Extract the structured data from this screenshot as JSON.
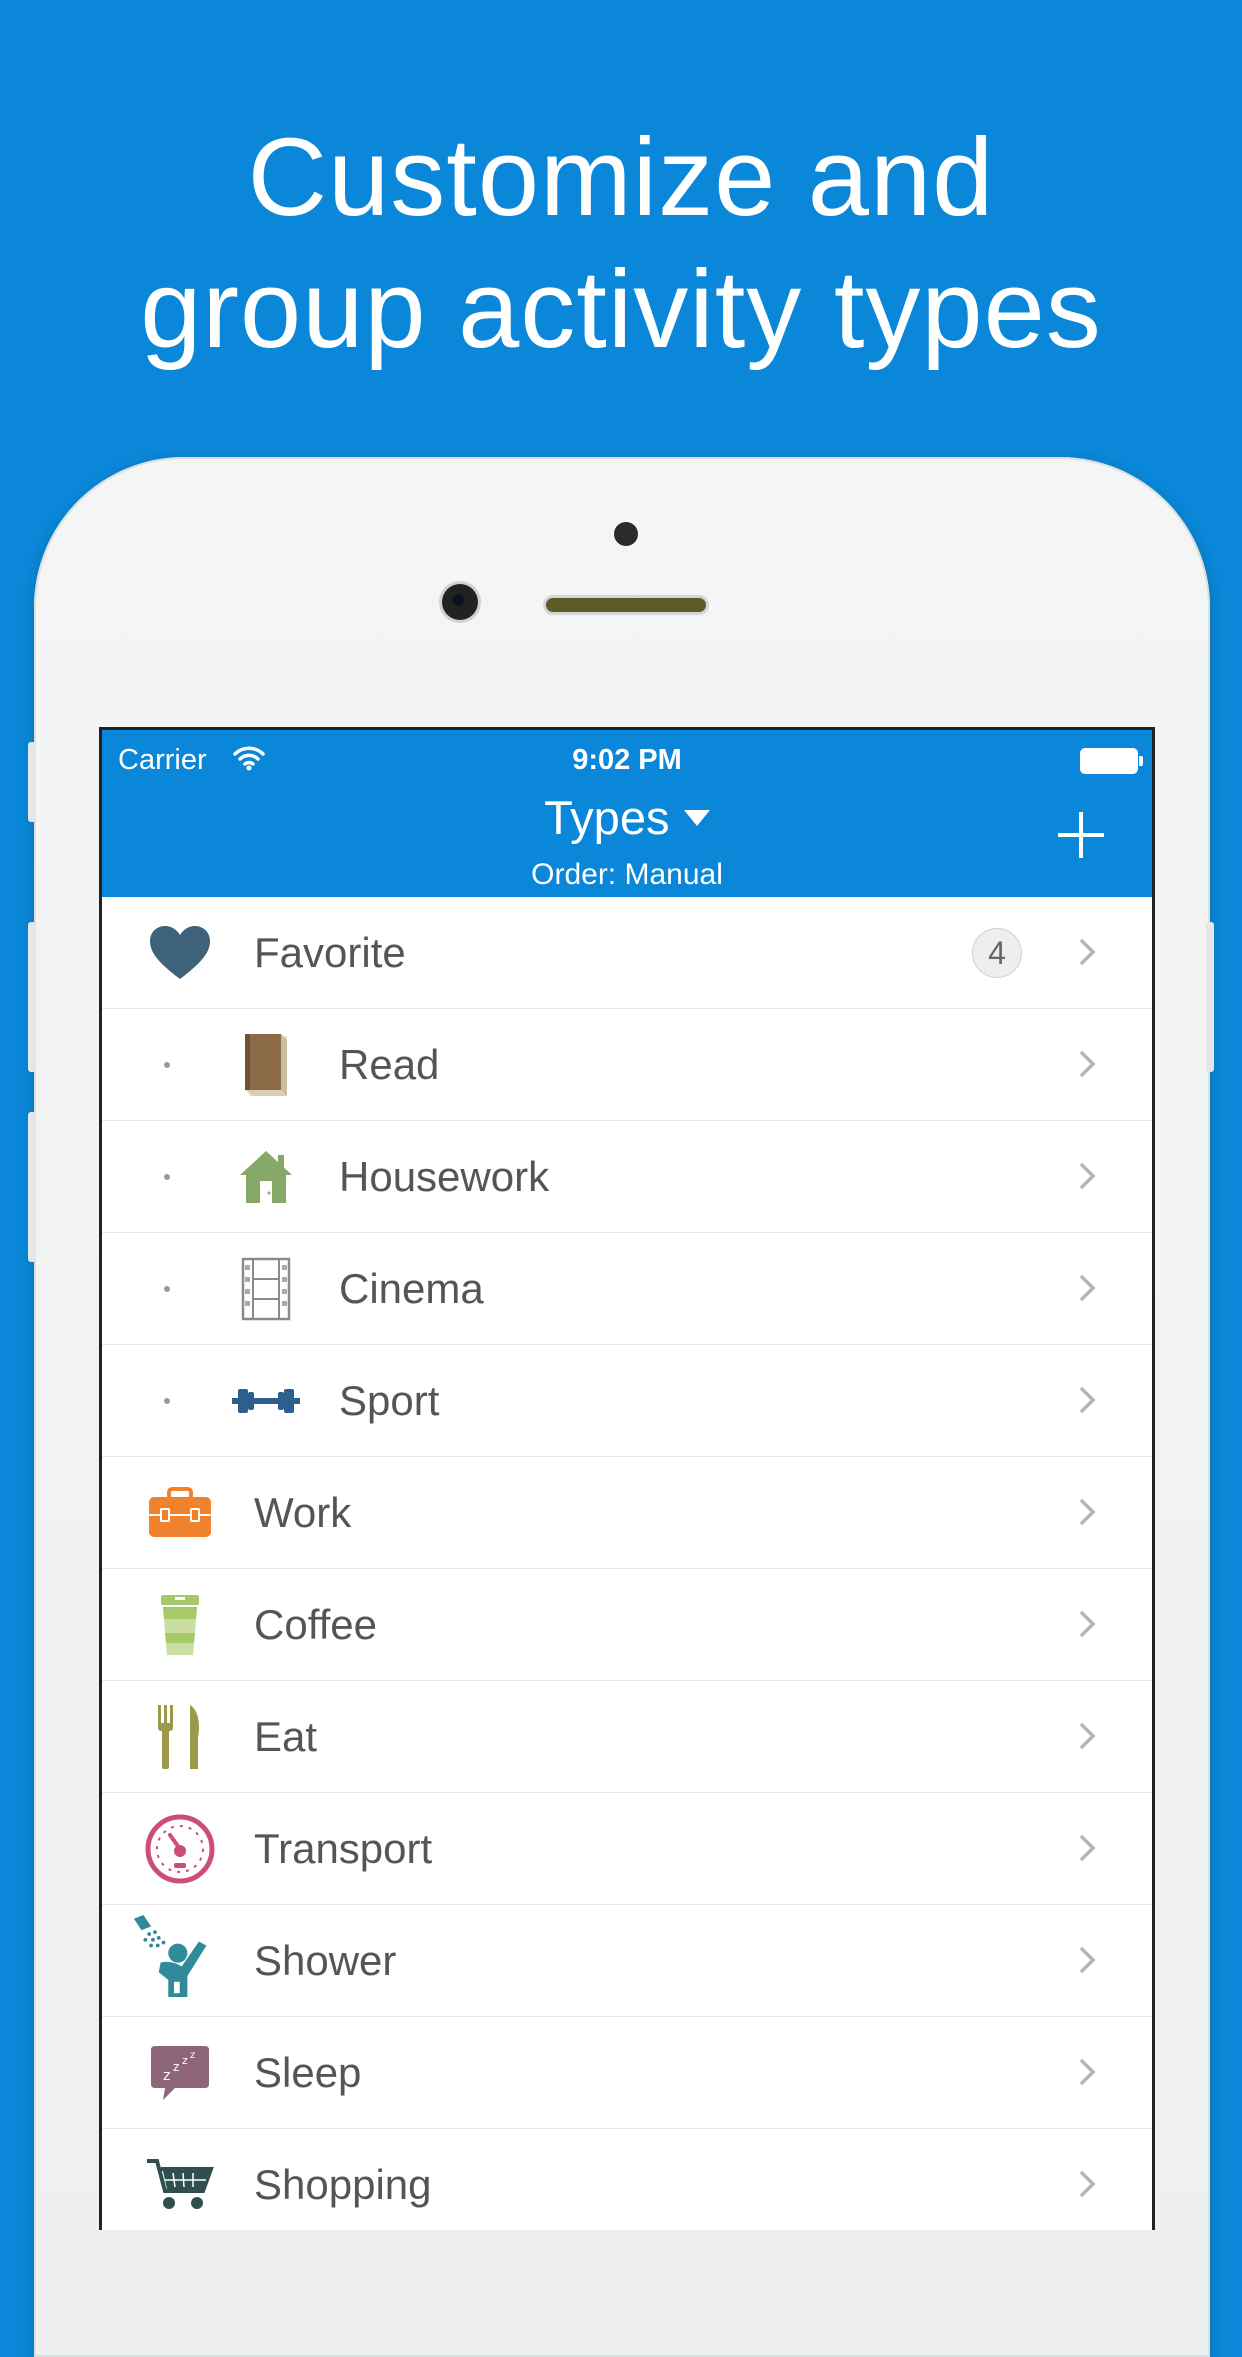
{
  "headline": {
    "line1": "Customize and",
    "line2": "group activity types"
  },
  "status_bar": {
    "carrier": "Carrier",
    "time": "9:02 PM"
  },
  "nav": {
    "title": "Types",
    "subtitle": "Order: Manual",
    "add_icon": "plus-icon"
  },
  "colors": {
    "brand_blue": "#0a87d8"
  },
  "rows": [
    {
      "label": "Favorite",
      "icon": "heart-icon",
      "badge": "4"
    },
    {
      "label": "Read",
      "icon": "book-icon"
    },
    {
      "label": "Housework",
      "icon": "house-icon"
    },
    {
      "label": "Cinema",
      "icon": "film-icon"
    },
    {
      "label": "Sport",
      "icon": "dumbbell-icon"
    },
    {
      "label": "Work",
      "icon": "toolbox-icon"
    },
    {
      "label": "Coffee",
      "icon": "coffee-cup-icon"
    },
    {
      "label": "Eat",
      "icon": "fork-knife-icon"
    },
    {
      "label": "Transport",
      "icon": "speedometer-icon"
    },
    {
      "label": "Shower",
      "icon": "shower-icon"
    },
    {
      "label": "Sleep",
      "icon": "sleep-bubble-icon"
    },
    {
      "label": "Shopping",
      "icon": "shopping-cart-icon"
    }
  ]
}
